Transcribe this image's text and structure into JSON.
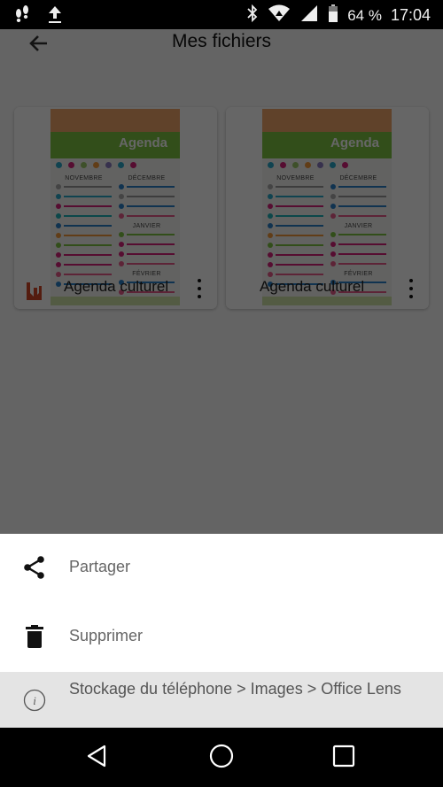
{
  "status_bar": {
    "left_icons": [
      "footsteps-icon",
      "upload-icon"
    ],
    "right_icons": [
      "bluetooth-icon",
      "wifi-icon",
      "signal-icon",
      "battery-icon"
    ],
    "battery_percent": "64 %",
    "time": "17:04"
  },
  "app_bar": {
    "back_icon": "arrow-left-icon",
    "title": "Mes fichiers"
  },
  "files": [
    {
      "title": "Agenda culturel",
      "app_icon": "office-lens-icon",
      "thumbnail": {
        "banner": "Agenda",
        "months": [
          "NOVEMBRE",
          "DÉCEMBRE",
          "JANVIER",
          "FÉVRIER"
        ]
      },
      "more_icon": "more-vertical-icon"
    },
    {
      "title": "Agenda culturel",
      "app_icon": null,
      "thumbnail": {
        "banner": "Agenda",
        "months": [
          "NOVEMBRE",
          "DÉCEMBRE",
          "JANVIER",
          "FÉVRIER"
        ]
      },
      "more_icon": "more-vertical-icon"
    }
  ],
  "bottom_sheet": {
    "items": [
      {
        "icon": "share-icon",
        "label": "Partager"
      },
      {
        "icon": "trash-icon",
        "label": "Supprimer"
      },
      {
        "icon": "info-icon",
        "label": "Stockage du téléphone > Images > Office Lens"
      }
    ]
  },
  "nav_bar": {
    "buttons": [
      "back-triangle-icon",
      "home-circle-icon",
      "recents-square-icon"
    ]
  },
  "colors": {
    "office_lens_brand": "#d24726",
    "thumbnail_green": "#7dc242",
    "thumbnail_orange": "#f0a56a",
    "info_row_bg": "#e4e4e4"
  }
}
